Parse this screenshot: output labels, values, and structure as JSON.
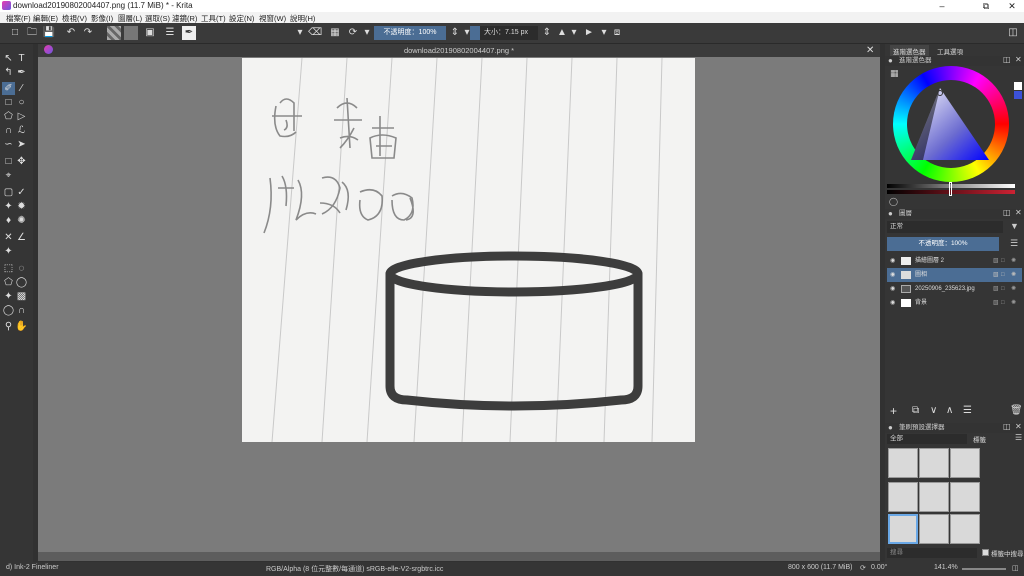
{
  "window": {
    "title": "download20190802004407.png (11.7 MiB)  * - Krita"
  },
  "menu": [
    "檔案(F)",
    "編輯(E)",
    "檢視(V)",
    "影像(I)",
    "圖層(L)",
    "選取(S)",
    "濾鏡(R)",
    "工具(T)",
    "設定(N)",
    "視窗(W)",
    "說明(H)"
  ],
  "toolbar": {
    "blend_mode": "正常",
    "opacity_label": "不透明度：100%",
    "size_label": "大小：",
    "size_value": "7.15 px"
  },
  "document_tab": "download20190802004407.png *",
  "dock": {
    "tabs": [
      "進階選色器",
      "工具選項"
    ],
    "color_panel_title": "進階選色器",
    "layers_title": "圖層",
    "layers_blend": "正常",
    "layers_opacity": "不透明度：100%",
    "layers": [
      {
        "name": "描繪圖層 2"
      },
      {
        "name": "圖相"
      },
      {
        "name": "20250906_235623.jpg"
      },
      {
        "name": "背景"
      }
    ],
    "presets_title": "筆刷預設選擇器",
    "presets_filter": "全部",
    "presets_tag": "標籤",
    "presets_search": "搜尋",
    "presets_checkbox": "標籤中搜尋"
  },
  "status": {
    "brush": "d) Ink-2 Fineliner",
    "color_model": "RGB/Alpha (8 位元整數/每通道)  sRGB-elle-V2-srgbtrc.icc",
    "doc_size": "800 x 600 (11.7 MiB)",
    "rotation": "0.00°",
    "zoom": "141.4%"
  },
  "colors": {
    "accent": "#4b6d94",
    "bg": "#313131"
  }
}
